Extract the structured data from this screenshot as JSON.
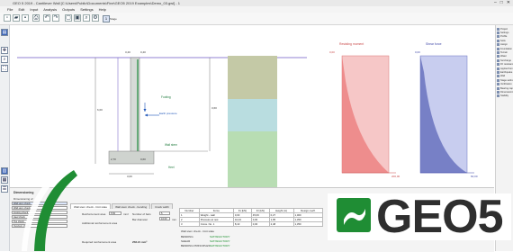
{
  "app": {
    "title": "GEO 5 2019 - Cantilever Wall [C:\\Users\\Public\\Documents\\Fine\\GEO5 2019 Examples\\Demo_03.gwl] - 1",
    "window_buttons": [
      "–",
      "□",
      "✕"
    ]
  },
  "menu": [
    "File",
    "Edit",
    "Input",
    "Analysis",
    "Outputs",
    "Settings",
    "Help"
  ],
  "toolbar": {
    "icons": [
      "new-file-icon",
      "open-folder-icon",
      "save-icon",
      "print-icon",
      "undo-icon",
      "redo-icon",
      "copy-view-icon",
      "paste-view-icon",
      "zoom-view-icon",
      "settings-icon"
    ],
    "stage_label": "1",
    "stage_select": "Stage"
  },
  "drawing": {
    "wall_label_1": "3,40",
    "wall_label_2": "0,40",
    "wall_label_3": "3,60",
    "height_label": "6,00",
    "base_label": "3,00",
    "load_label": "Earth pressure",
    "dim_1": "2,70",
    "dim_2": "0,60",
    "green_note_1": "Footing",
    "green_note_2": "Wall stem",
    "green_note_3": "Heel"
  },
  "stress_charts": [
    {
      "title": "Resisting moment",
      "color": "#f08a8a",
      "stroke": "#c94a4a",
      "axis_top": "0,00",
      "axis_bottom": "200,00"
    },
    {
      "title": "Shear force",
      "color": "#9aa4dd",
      "stroke": "#4048a8",
      "axis_top": "0,00",
      "axis_bottom": "60,00"
    }
  ],
  "bottom_panel": {
    "section_title": "Dimensioning",
    "left_list_header": "Dimensioning of",
    "left_list": [
      "Wall stem check",
      "Wall stem check",
      "Footing check",
      "Heel check",
      "Toe check",
      "Overturn check"
    ],
    "tabs": [
      "Wall stem check - limit state",
      "Wall stem check - bending",
      "Crack width"
    ],
    "fields": [
      {
        "label": "Reinforcement area",
        "value": "5.50",
        "unit": "mm²"
      },
      {
        "label": "Additional reinforcement area",
        "value": "",
        "unit": ""
      },
      {
        "label": "Number of bars",
        "value": "5",
        "unit": ""
      },
      {
        "label": "Bar diameter",
        "value": "16.00",
        "unit": "mm"
      }
    ],
    "required_label": "Required reinforcement area",
    "required_value": "258.21 mm²",
    "table": {
      "headers": [
        "Number",
        "Force",
        "Fx [kN]",
        "Fz [kN]",
        "Height (m)",
        "Design coeff."
      ],
      "rows": [
        [
          "1",
          "Weight - wall",
          "0,00",
          "45,06",
          "0,27",
          "1,000"
        ],
        [
          "2",
          "Pressure at rest",
          "44,34",
          "0,00",
          "1,95",
          "1,350"
        ],
        [
          "3",
          "Cross. No. 1",
          "8,10",
          "0,00",
          "2,48",
          "1,350"
        ]
      ]
    },
    "results": [
      {
        "label": "Wall stem check - limit state",
        "status": "SATISFACTORY"
      },
      {
        "label": "BENDING",
        "status": "SATISFACTORY"
      },
      {
        "label": "SHEAR",
        "status": "SATISFACTORY"
      },
      {
        "label": "BENDING PRINCIPLES",
        "status": "SATISFACTORY"
      }
    ]
  },
  "right_panel": {
    "items": [
      "Project",
      "Settings",
      "Profile",
      "Soils",
      "Assign",
      "Foundation",
      "Terrain",
      "Water",
      "Surcharge",
      "FF resistance",
      "Applied forces",
      "Earthquake",
      "Wall",
      "Stage settings",
      "Verification",
      "Bearing cap.",
      "Dimensioning",
      "Stability"
    ]
  },
  "logo": {
    "text": "GEO5",
    "brand_color": "#1f8d34"
  },
  "colors": {
    "soil_top": "#c4c9a6",
    "soil_mid": "#b9dde0",
    "soil_bottom": "#b8ddb3"
  }
}
